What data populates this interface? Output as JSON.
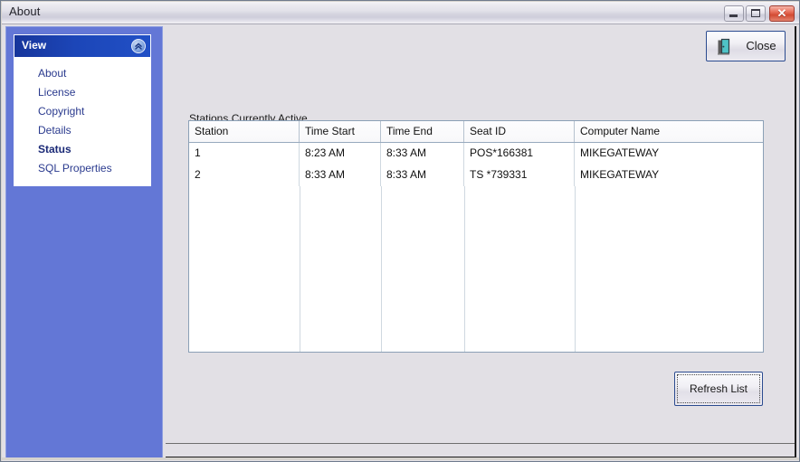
{
  "window": {
    "title": "About",
    "controls": {
      "minimize": "minimize",
      "maximize": "maximize",
      "close": "✕"
    }
  },
  "sidebar": {
    "panel_title": "View",
    "collapse_icon": "chevron-double-up-icon",
    "items": [
      {
        "label": "About",
        "selected": false
      },
      {
        "label": "License",
        "selected": false
      },
      {
        "label": "Copyright",
        "selected": false
      },
      {
        "label": "Details",
        "selected": false
      },
      {
        "label": "Status",
        "selected": true
      },
      {
        "label": "SQL Properties",
        "selected": false
      }
    ]
  },
  "content": {
    "close_button": {
      "label": "Close",
      "icon": "exit-door-icon"
    },
    "section_label": "Stations Currently Active",
    "refresh_button": {
      "label": "Refresh List"
    },
    "grid": {
      "columns": [
        "Station",
        "Time Start",
        "Time End",
        "Seat ID",
        "Computer Name"
      ],
      "rows": [
        {
          "station": "1",
          "time_start": "8:23 AM",
          "time_end": "8:33 AM",
          "seat_id": "POS*166381",
          "computer_name": "MIKEGATEWAY"
        },
        {
          "station": "2",
          "time_start": "8:33 AM",
          "time_end": "8:33 AM",
          "seat_id": "TS *739331",
          "computer_name": "MIKEGATEWAY"
        }
      ]
    }
  },
  "colors": {
    "sidebar_blue": "#6377d6",
    "panel_header_blue": "#1c46b8",
    "link_text": "#2a3a8e",
    "button_border": "#2b4b8f",
    "grid_border": "#8ba0b6",
    "door_icon": "#4fc3c7"
  }
}
